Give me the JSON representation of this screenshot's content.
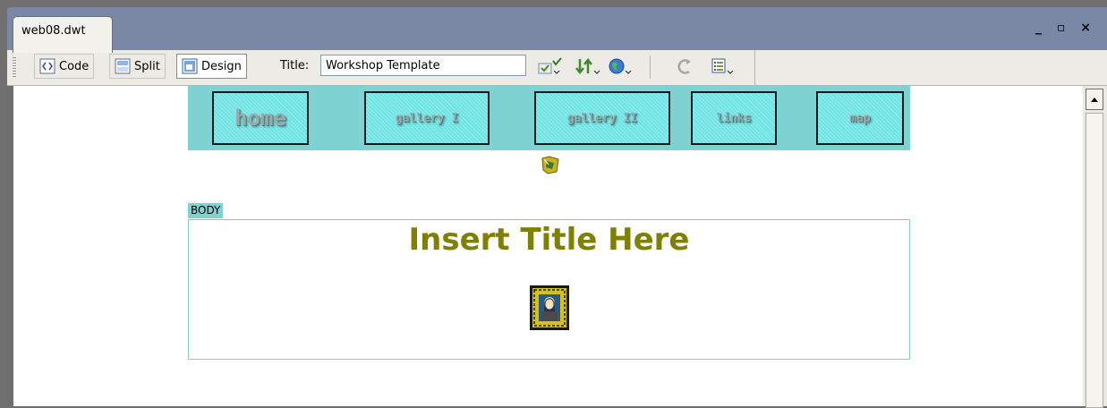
{
  "window": {
    "tab_title": "web08.dwt",
    "controls": "_ ▫ ×"
  },
  "toolbar": {
    "code_label": "Code",
    "split_label": "Split",
    "design_label": "Design",
    "title_label": "Title:",
    "title_value": "Workshop Template"
  },
  "nav": {
    "items": [
      {
        "label": "home"
      },
      {
        "label": "gallery I"
      },
      {
        "label": "gallery II"
      },
      {
        "label": "links"
      },
      {
        "label": "map"
      }
    ]
  },
  "body": {
    "tag": "BODY",
    "title": "Insert Title Here"
  },
  "colors": {
    "nav_background": "#7ed3d2",
    "nav_button": "#6fe4e4",
    "title_color": "#808000",
    "tab_bar": "#7b88a5"
  }
}
